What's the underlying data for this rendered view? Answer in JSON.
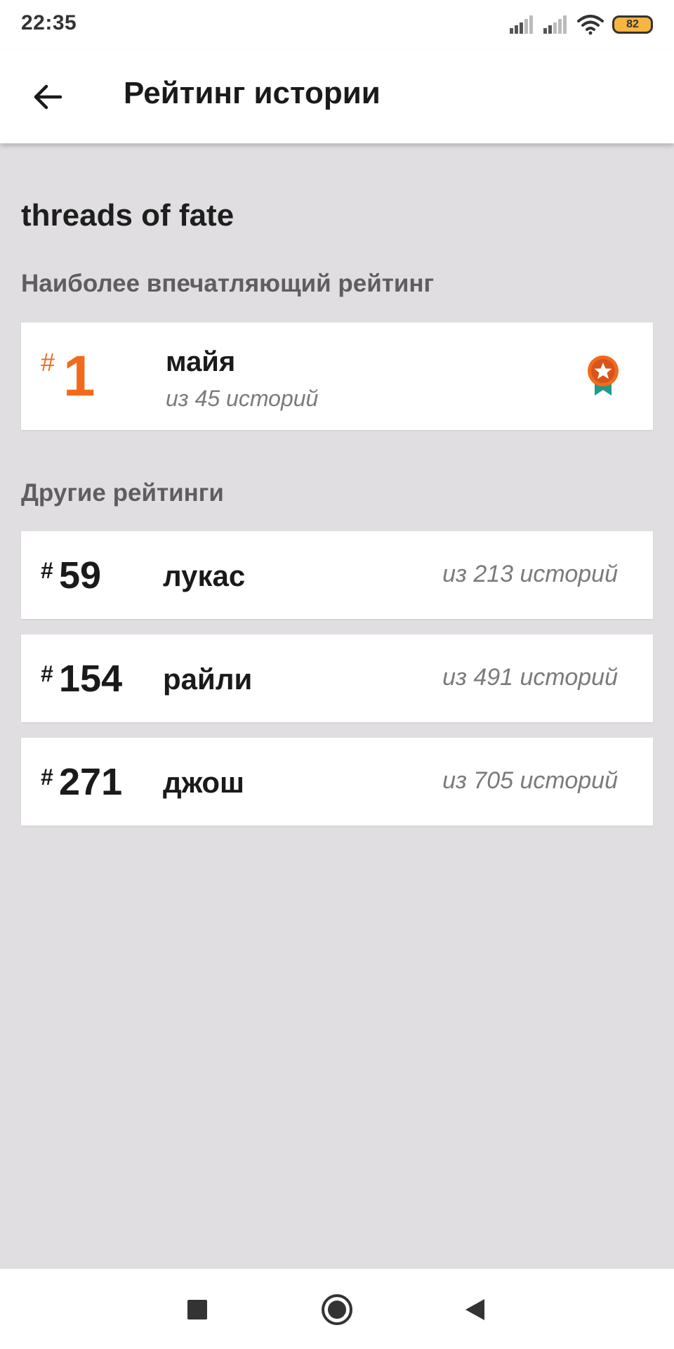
{
  "status_bar": {
    "time": "22:35",
    "battery": "82",
    "icons": [
      "signal-icon",
      "signal-icon",
      "wifi-icon",
      "battery-icon"
    ]
  },
  "app_bar": {
    "back_icon": "arrow-left-icon",
    "title": "Рейтинг истории"
  },
  "story": {
    "title": "threads of fate"
  },
  "top_section": {
    "label": "Наиболее впечатляющий рейтинг",
    "hash": "#",
    "rank": "1",
    "name": "майя",
    "sub": "из 45 историй",
    "badge_icon": "medal-star-icon",
    "accent_color": "#f26a1b"
  },
  "other_section": {
    "label": "Другие рейтинги",
    "items": [
      {
        "hash": "#",
        "rank": "59",
        "name": "лукас",
        "sub": "из 213 историй"
      },
      {
        "hash": "#",
        "rank": "154",
        "name": "райли",
        "sub": "из 491 историй"
      },
      {
        "hash": "#",
        "rank": "271",
        "name": "джош",
        "sub": "из 705 историй"
      }
    ]
  },
  "nav_bar": {
    "icons": [
      "square-icon",
      "circle-icon",
      "triangle-back-icon"
    ]
  }
}
